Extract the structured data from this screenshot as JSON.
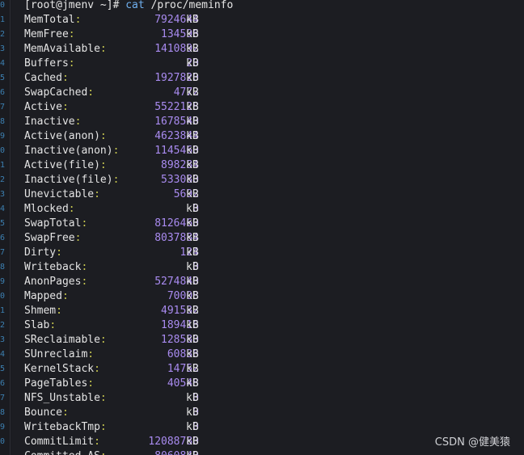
{
  "prompt": {
    "user_host": "[root@jmenv ~]",
    "symbol": "#",
    "command": "cat",
    "argument": "/proc/meminfo"
  },
  "gutter_numbers": [
    "0",
    "1",
    "2",
    "3",
    "4",
    "5",
    "6",
    "7",
    "8",
    "9",
    "0",
    "1",
    "2",
    "3",
    "4",
    "5",
    "6",
    "7",
    "8",
    "9",
    "0",
    "1",
    "2",
    "3",
    "4",
    "5",
    "6",
    "7",
    "8",
    "9",
    "0"
  ],
  "colors": {
    "background": "#1c1d22",
    "key_text": "#e4e4e4",
    "colon": "#c8c850",
    "value": "#a98bf0",
    "command": "#6fb0ef"
  },
  "meminfo": [
    {
      "key": "MemTotal",
      "value": "7924644",
      "unit": "kB"
    },
    {
      "key": "MemFree",
      "value": "134596",
      "unit": "kB"
    },
    {
      "key": "MemAvailable",
      "value": "1410892",
      "unit": "kB"
    },
    {
      "key": "Buffers",
      "value": "20",
      "unit": "kB"
    },
    {
      "key": "Cached",
      "value": "1927820",
      "unit": "kB"
    },
    {
      "key": "SwapCached",
      "value": "4772",
      "unit": "kB"
    },
    {
      "key": "Active",
      "value": "5522128",
      "unit": "kB"
    },
    {
      "key": "Inactive",
      "value": "1678540",
      "unit": "kB"
    },
    {
      "key": "Active(anon)",
      "value": "4623844",
      "unit": "kB"
    },
    {
      "key": "Inactive(anon)",
      "value": "1145460",
      "unit": "kB"
    },
    {
      "key": "Active(file)",
      "value": "898284",
      "unit": "kB"
    },
    {
      "key": "Inactive(file)",
      "value": "533080",
      "unit": "kB"
    },
    {
      "key": "Unevictable",
      "value": "5692",
      "unit": "kB"
    },
    {
      "key": "Mlocked",
      "value": "0",
      "unit": "kB"
    },
    {
      "key": "SwapTotal",
      "value": "8126460",
      "unit": "kB"
    },
    {
      "key": "SwapFree",
      "value": "8037884",
      "unit": "kB"
    },
    {
      "key": "Dirty",
      "value": "124",
      "unit": "kB"
    },
    {
      "key": "Writeback",
      "value": "0",
      "unit": "kB"
    },
    {
      "key": "AnonPages",
      "value": "5274840",
      "unit": "kB"
    },
    {
      "key": "Mapped",
      "value": "70008",
      "unit": "kB"
    },
    {
      "key": "Shmem",
      "value": "491532",
      "unit": "kB"
    },
    {
      "key": "Slab",
      "value": "189416",
      "unit": "kB"
    },
    {
      "key": "SReclaimable",
      "value": "128580",
      "unit": "kB"
    },
    {
      "key": "SUnreclaim",
      "value": "60836",
      "unit": "kB"
    },
    {
      "key": "KernelStack",
      "value": "14752",
      "unit": "kB"
    },
    {
      "key": "PageTables",
      "value": "40548",
      "unit": "kB"
    },
    {
      "key": "NFS_Unstable",
      "value": "0",
      "unit": "kB"
    },
    {
      "key": "Bounce",
      "value": "0",
      "unit": "kB"
    },
    {
      "key": "WritebackTmp",
      "value": "0",
      "unit": "kB"
    },
    {
      "key": "CommitLimit",
      "value": "12088780",
      "unit": "kB"
    },
    {
      "key": "Committed_AS",
      "value": "8060840",
      "unit": "kB"
    }
  ],
  "watermark": "CSDN @健美猿"
}
